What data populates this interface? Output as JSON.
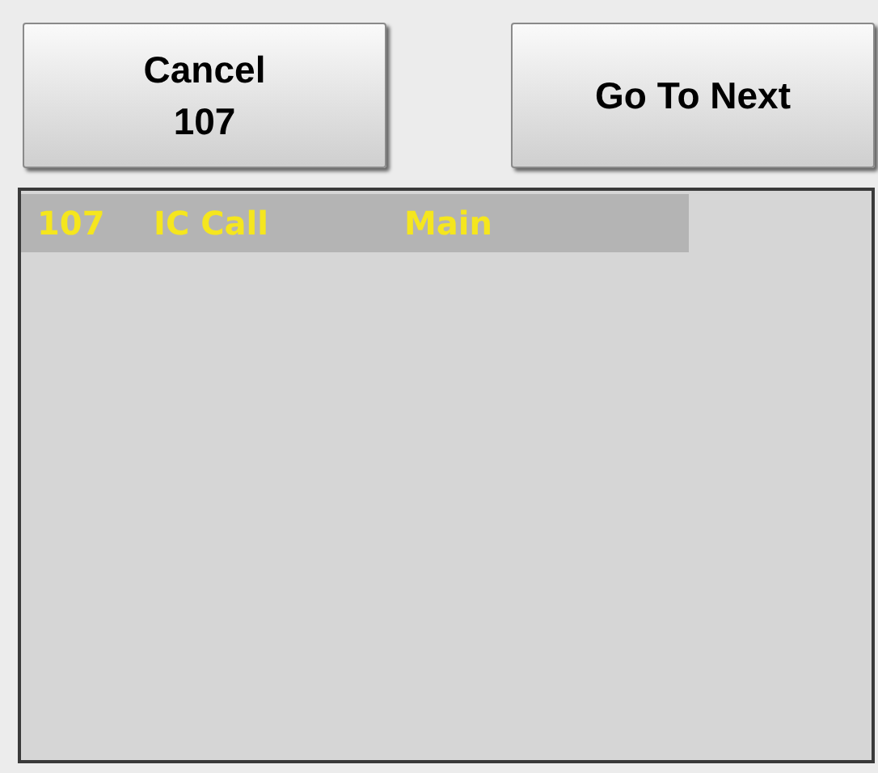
{
  "buttons": [
    {
      "label": "Cancel\n107"
    },
    {
      "label": "Go To Next"
    }
  ],
  "list": {
    "rows": [
      {
        "cells": [
          "107",
          "IC Call",
          "Main"
        ]
      }
    ]
  }
}
